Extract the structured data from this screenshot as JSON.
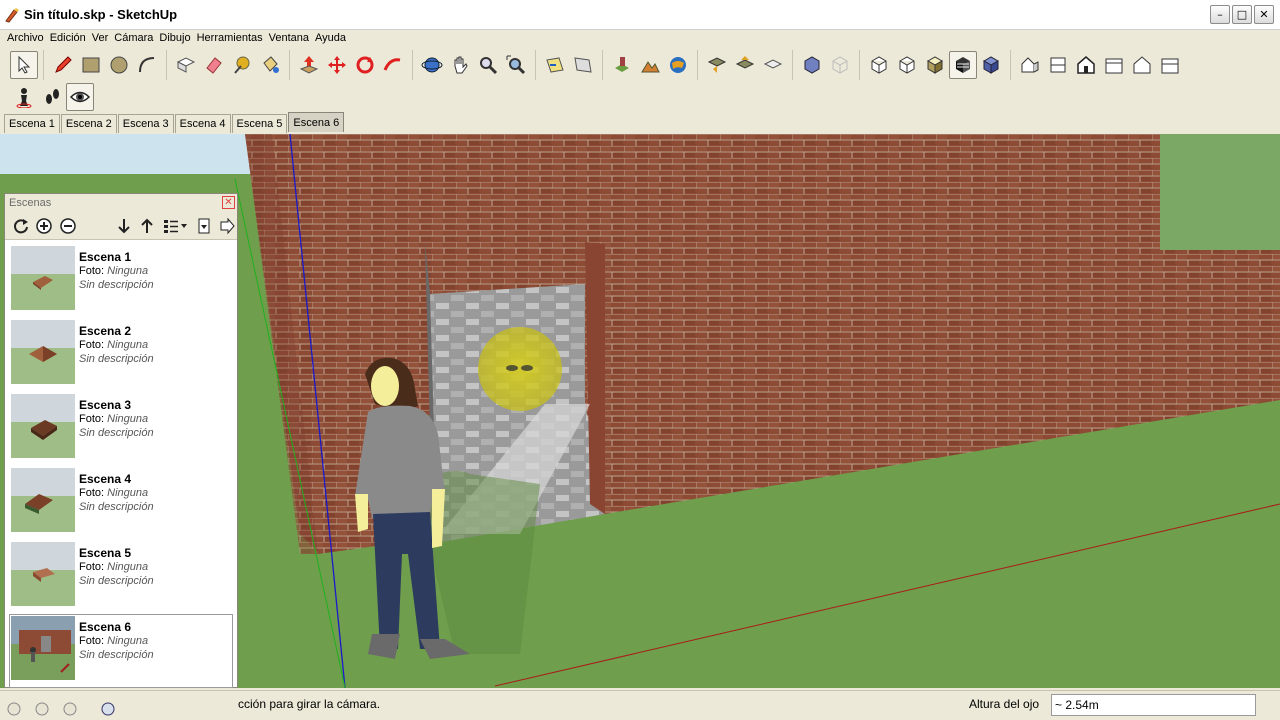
{
  "window": {
    "title": "Sin título.skp - SketchUp",
    "min_label": "–",
    "max_label": "□",
    "close_label": "✕"
  },
  "menus": [
    "Archivo",
    "Edición",
    "Ver",
    "Cámara",
    "Dibujo",
    "Herramientas",
    "Ventana",
    "Ayuda"
  ],
  "toolbar": {
    "tools": [
      {
        "name": "select-tool",
        "icon": "arrow-icon"
      },
      {
        "name": "pencil-tool",
        "icon": "pencil-icon"
      },
      {
        "name": "rectangle-tool",
        "icon": "rectangle-icon"
      },
      {
        "name": "circle-tool",
        "icon": "circle-icon"
      },
      {
        "name": "arc-tool",
        "icon": "arc-icon"
      },
      {
        "name": "make-component-tool",
        "icon": "component-icon"
      },
      {
        "name": "eraser-tool",
        "icon": "eraser-icon"
      },
      {
        "name": "tape-measure-tool",
        "icon": "tape-icon"
      },
      {
        "name": "paint-bucket-tool",
        "icon": "bucket-icon"
      },
      {
        "name": "push-pull-tool",
        "icon": "pushpull-icon"
      },
      {
        "name": "move-tool",
        "icon": "move-icon"
      },
      {
        "name": "rotate-tool",
        "icon": "rotate-icon"
      },
      {
        "name": "follow-me-tool",
        "icon": "followme-icon"
      },
      {
        "name": "orbit-tool",
        "icon": "orbit-icon"
      },
      {
        "name": "pan-tool",
        "icon": "hand-icon"
      },
      {
        "name": "zoom-tool",
        "icon": "zoom-icon"
      },
      {
        "name": "zoom-extents-tool",
        "icon": "zoom-extents-icon"
      },
      {
        "name": "previous-view-tool",
        "icon": "previous-icon"
      },
      {
        "name": "next-view-tool",
        "icon": "next-icon"
      },
      {
        "name": "add-location-tool",
        "icon": "location-icon"
      },
      {
        "name": "toggle-terrain-tool",
        "icon": "terrain-icon"
      },
      {
        "name": "google-earth-tool",
        "icon": "earth-icon"
      },
      {
        "name": "get-models-tool",
        "icon": "get-models-icon"
      },
      {
        "name": "share-model-tool",
        "icon": "share-model-icon"
      },
      {
        "name": "share-component-tool",
        "icon": "share-component-icon"
      },
      {
        "name": "xray-style",
        "icon": "xray-icon"
      },
      {
        "name": "wireframe-style",
        "icon": "wireframe-icon"
      },
      {
        "name": "hidden-line-style",
        "icon": "hidden-line-icon"
      },
      {
        "name": "shaded-style",
        "icon": "shaded-icon"
      },
      {
        "name": "shaded-textures-style",
        "icon": "textures-icon"
      },
      {
        "name": "monochrome-style",
        "icon": "monochrome-icon"
      },
      {
        "name": "iso-view",
        "icon": "iso-house-icon"
      },
      {
        "name": "top-view",
        "icon": "top-house-icon"
      },
      {
        "name": "front-view",
        "icon": "front-house-icon"
      },
      {
        "name": "right-view",
        "icon": "right-house-icon"
      },
      {
        "name": "back-view",
        "icon": "back-house-icon"
      },
      {
        "name": "left-view",
        "icon": "left-house-icon"
      }
    ],
    "walk_tools": [
      {
        "name": "position-camera-tool",
        "icon": "position-camera-icon"
      },
      {
        "name": "walk-tool",
        "icon": "footprints-icon"
      },
      {
        "name": "look-around-tool",
        "icon": "eye-icon"
      }
    ]
  },
  "tabs": [
    {
      "label": "Escena 1",
      "active": false
    },
    {
      "label": "Escena 2",
      "active": false
    },
    {
      "label": "Escena 3",
      "active": false
    },
    {
      "label": "Escena 4",
      "active": false
    },
    {
      "label": "Escena 5",
      "active": false
    },
    {
      "label": "Escena 6",
      "active": true
    }
  ],
  "scenes_panel": {
    "title": "Escenas",
    "close_label": "✕",
    "items": [
      {
        "name": "Escena 1",
        "foto_label": "Foto:",
        "foto_value": "Ninguna",
        "desc": "Sin descripción",
        "active": false
      },
      {
        "name": "Escena 2",
        "foto_label": "Foto:",
        "foto_value": "Ninguna",
        "desc": "Sin descripción",
        "active": false
      },
      {
        "name": "Escena 3",
        "foto_label": "Foto:",
        "foto_value": "Ninguna",
        "desc": "Sin descripción",
        "active": false
      },
      {
        "name": "Escena 4",
        "foto_label": "Foto:",
        "foto_value": "Ninguna",
        "desc": "Sin descripción",
        "active": false
      },
      {
        "name": "Escena 5",
        "foto_label": "Foto:",
        "foto_value": "Ninguna",
        "desc": "Sin descripción",
        "active": false
      },
      {
        "name": "Escena 6",
        "foto_label": "Foto:",
        "foto_value": "Ninguna",
        "desc": "Sin descripción",
        "active": true
      }
    ]
  },
  "status": {
    "text": "cción para girar la cámara.",
    "measure_label": "Altura del ojo",
    "measure_value": "~ 2.54m"
  },
  "colors": {
    "brick": "#8d4a35",
    "grass": "#6f9e4c",
    "sky": "#cde3ee",
    "accent": "#2a6fc0"
  }
}
